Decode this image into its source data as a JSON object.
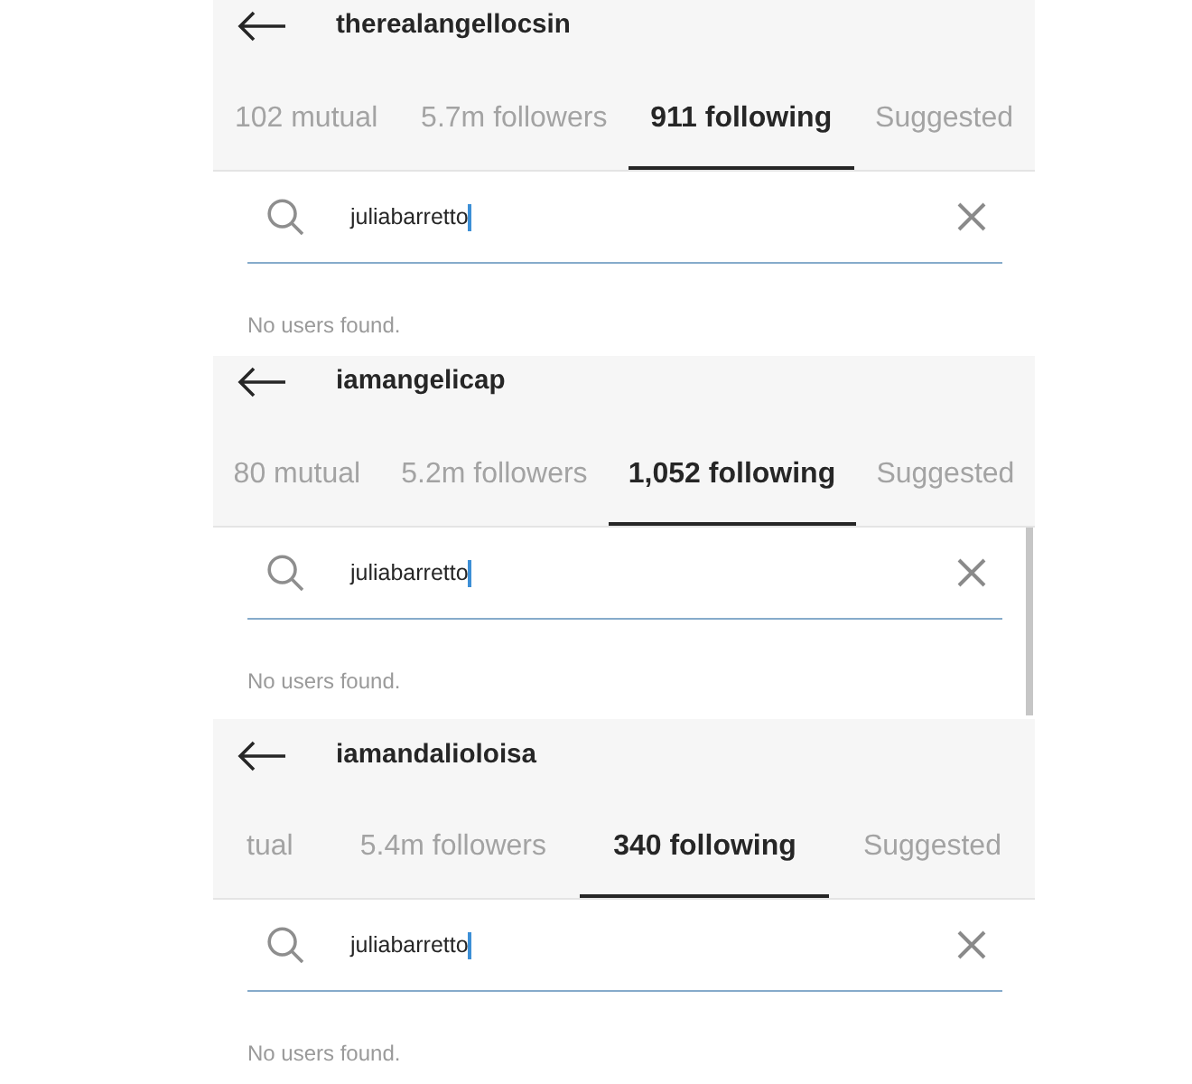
{
  "panels": [
    {
      "username": "therealangellocsin",
      "tabs": [
        {
          "label": "102 mutual",
          "selected": false
        },
        {
          "label": "5.7m followers",
          "selected": false
        },
        {
          "label": "911 following",
          "selected": true
        },
        {
          "label": "Suggested",
          "selected": false
        }
      ],
      "search": {
        "value": "juliabarretto",
        "focused": true
      },
      "message": "No users found.",
      "scrollbar": false
    },
    {
      "username": "iamangelicap",
      "tabs": [
        {
          "label": "80 mutual",
          "selected": false
        },
        {
          "label": "5.2m followers",
          "selected": false
        },
        {
          "label": "1,052 following",
          "selected": true
        },
        {
          "label": "Suggested",
          "selected": false
        }
      ],
      "search": {
        "value": "juliabarretto",
        "focused": true
      },
      "message": "No users found.",
      "scrollbar": true
    },
    {
      "username": "iamandalioloisa",
      "tabs": [
        {
          "label": "tual",
          "selected": false
        },
        {
          "label": "5.4m followers",
          "selected": false
        },
        {
          "label": "340 following",
          "selected": true
        },
        {
          "label": "Suggested",
          "selected": false
        }
      ],
      "search": {
        "value": "juliabarretto",
        "focused": true
      },
      "message": "No users found.",
      "scrollbar": false
    }
  ]
}
